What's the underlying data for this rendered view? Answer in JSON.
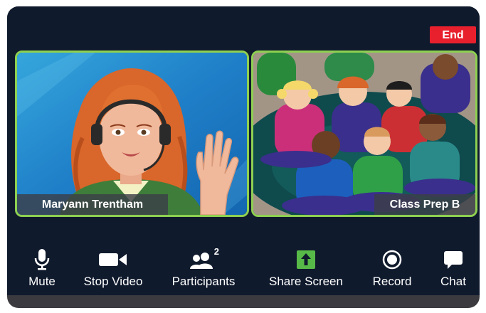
{
  "meeting": {
    "end_label": "End",
    "accent_color": "#8ed051",
    "end_color": "#e8202d"
  },
  "participants": [
    {
      "name": "Maryann Trentham"
    },
    {
      "name": "Class Prep B"
    }
  ],
  "toolbar": {
    "participants_count": "2",
    "items": [
      {
        "label": "Mute",
        "icon": "microphone-icon"
      },
      {
        "label": "Stop Video",
        "icon": "video-camera-icon"
      },
      {
        "label": "Participants",
        "icon": "participants-icon"
      },
      {
        "label": "Share Screen",
        "icon": "share-screen-icon"
      },
      {
        "label": "Record",
        "icon": "record-icon"
      },
      {
        "label": "Chat",
        "icon": "chat-bubble-icon"
      }
    ]
  }
}
